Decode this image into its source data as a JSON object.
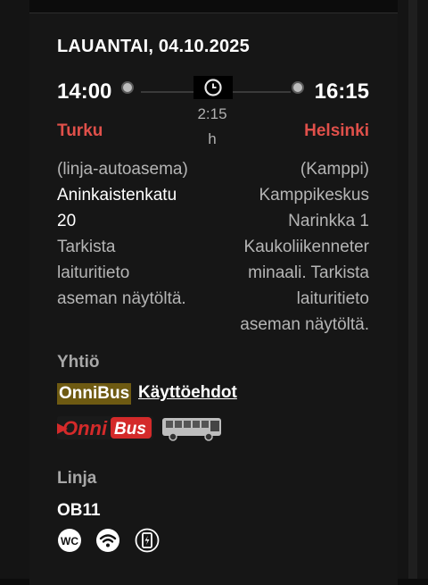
{
  "trip": {
    "date": "LAUANTAI, 04.10.2025",
    "departure": {
      "time": "14:00",
      "city": "Turku",
      "details": [
        "(linja-autoasema)",
        "Aninkaistenkatu",
        "20",
        "Tarkista",
        "laituritieto",
        "aseman näytöltä."
      ]
    },
    "arrival": {
      "time": "16:15",
      "city": "Helsinki",
      "details": [
        "(Kamppi)",
        "Kamppikeskus",
        "Narinkka 1",
        "Kaukoliikenneter",
        "minaali. Tarkista",
        "laituritieto",
        "aseman näytöltä."
      ]
    },
    "duration": {
      "value": "2:15",
      "unit": "h"
    }
  },
  "company": {
    "label": "Yhtiö",
    "name": "OnniBus",
    "terms_link": "Käyttöehdot",
    "logo_text": "OnniBus"
  },
  "route": {
    "label": "Linja",
    "code": "OB11",
    "amenities": [
      "WC"
    ]
  },
  "colors": {
    "city": "#e0504a",
    "company_highlight": "#6e5a12",
    "logo_red": "#d42a2a"
  },
  "icons": [
    "clock-icon",
    "wc-icon",
    "wifi-icon",
    "charging-icon",
    "bus-icon"
  ]
}
